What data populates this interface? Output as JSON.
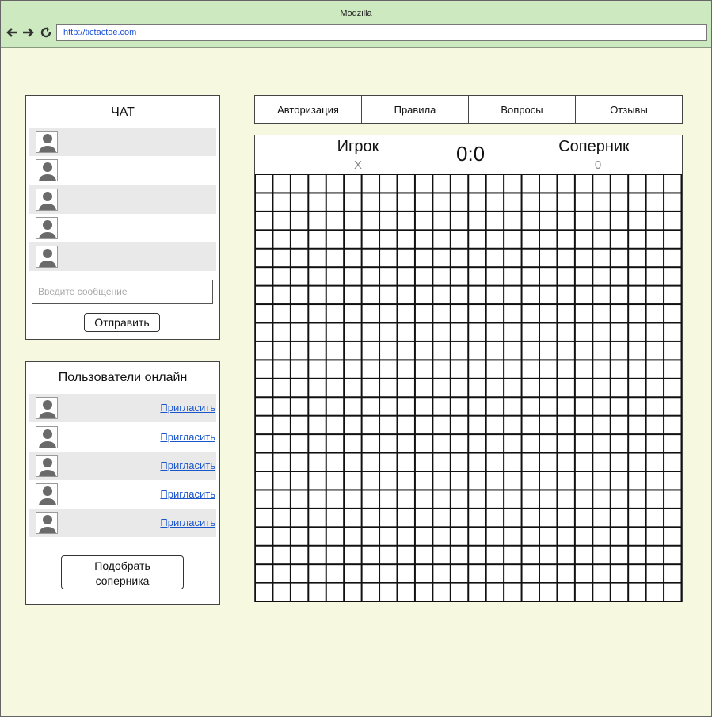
{
  "browser": {
    "title": "Moqzilla",
    "url": "http://tictactoe.com",
    "back_icon": "back-arrow-icon",
    "forward_icon": "forward-arrow-icon",
    "reload_icon": "reload-icon"
  },
  "chat": {
    "title": "ЧАТ",
    "rows": 5,
    "input_placeholder": "Введите сообщение",
    "send_label": "Отправить"
  },
  "online": {
    "title": "Пользователи онлайн",
    "invite_label": "Пригласить",
    "users": [
      {
        "invite": "Пригласить"
      },
      {
        "invite": "Пригласить"
      },
      {
        "invite": "Пригласить"
      },
      {
        "invite": "Пригласить"
      },
      {
        "invite": "Пригласить"
      }
    ],
    "match_label_line1": "Подобрать",
    "match_label_line2": "соперника"
  },
  "tabs": [
    "Авторизация",
    "Правила",
    "Вопросы",
    "Отзывы"
  ],
  "game": {
    "player_label": "Игрок",
    "player_mark": "X",
    "opponent_label": "Соперник",
    "opponent_mark": "0",
    "score": "0:0"
  }
}
